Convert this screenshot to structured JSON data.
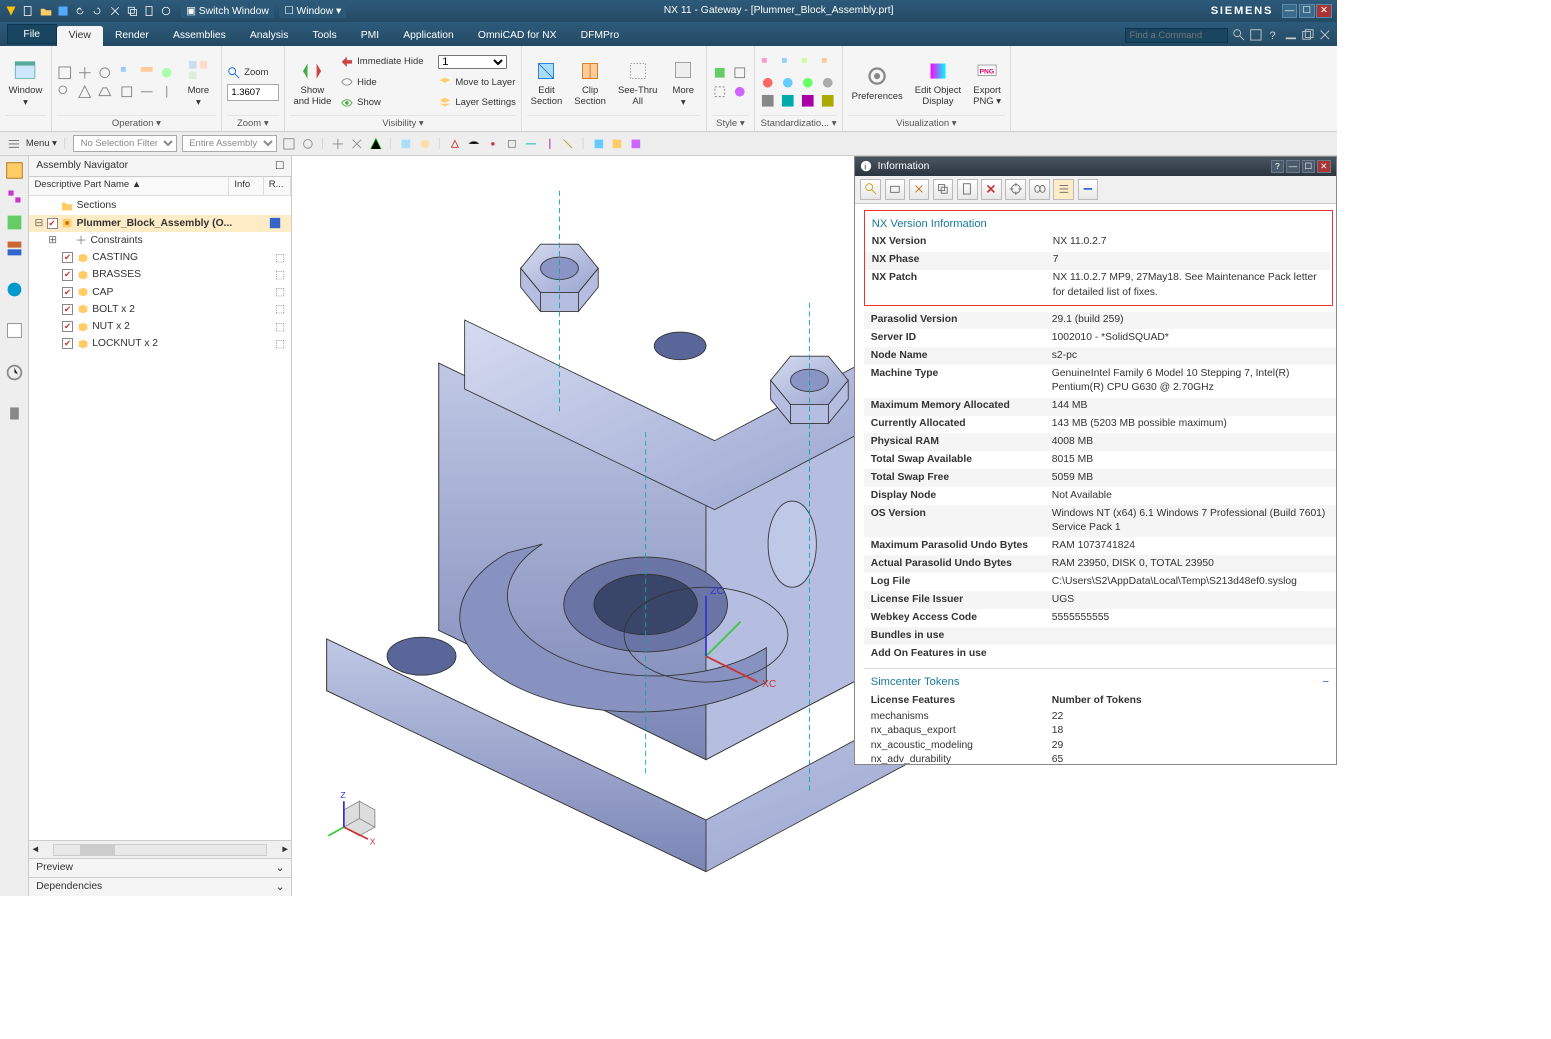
{
  "titlebar": {
    "switch_window": "Switch Window",
    "window_menu": "Window ▾",
    "title": "NX 11 - Gateway - [Plummer_Block_Assembly.prt]",
    "brand": "SIEMENS"
  },
  "tabs": {
    "file": "File",
    "view": "View",
    "render": "Render",
    "assemblies": "Assemblies",
    "analysis": "Analysis",
    "tools": "Tools",
    "pmi": "PMI",
    "application": "Application",
    "omnicad": "OmniCAD for NX",
    "dfmpro": "DFMPro",
    "find_placeholder": "Find a Command"
  },
  "ribbon": {
    "window": "Window",
    "operation_label": "Operation",
    "more1": "More",
    "zoom": "Zoom",
    "zoom_value": "1.3607",
    "zoom_label": "Zoom",
    "show_hide": "Show\nand Hide",
    "imm_hide": "Immediate Hide",
    "hide": "Hide",
    "show": "Show",
    "vis_combo": "1",
    "move_layer": "Move to Layer",
    "layer_settings": "Layer Settings",
    "visibility": "Visibility",
    "edit_section": "Edit\nSection",
    "clip_section": "Clip\nSection",
    "seethru": "See-Thru\nAll",
    "more2": "More",
    "style_label": "Style",
    "standard_label": "Standardizatio...",
    "prefs": "Preferences",
    "edit_obj": "Edit Object\nDisplay",
    "export_png": "Export\nPNG ▾",
    "viz_label": "Visualization"
  },
  "optbar": {
    "menu": "Menu ▾",
    "filter": "No Selection Filter",
    "scope": "Entire Assembly"
  },
  "nav": {
    "title": "Assembly Navigator",
    "col_name": "Descriptive Part Name  ▲",
    "col_info": "Info",
    "col_r": "R...",
    "sections": "Sections",
    "root": "Plummer_Block_Assembly (O...",
    "constraints": "Constraints",
    "casting": "CASTING",
    "brasses": "BRASSES",
    "cap": "CAP",
    "bolt": "BOLT x 2",
    "nut": "NUT x 2",
    "locknut": "LOCKNUT x 2",
    "preview": "Preview",
    "dependencies": "Dependencies"
  },
  "info": {
    "title": "Information",
    "section_header": "NX Version Information",
    "rows": [
      {
        "k": "NX Version",
        "v": "NX 11.0.2.7"
      },
      {
        "k": "NX Phase",
        "v": "7"
      },
      {
        "k": "NX Patch",
        "v": "NX 11.0.2.7 MP9, 27May18. See Maintenance Pack letter for detailed list of fixes."
      }
    ],
    "rows2": [
      {
        "k": "Parasolid Version",
        "v": "29.1 (build 259)"
      },
      {
        "k": "Server ID",
        "v": "1002010 - *SolidSQUAD*"
      },
      {
        "k": "Node Name",
        "v": "s2-pc"
      },
      {
        "k": "Machine Type",
        "v": "GenuineIntel Family 6 Model 10 Stepping 7, Intel(R) Pentium(R) CPU G630 @ 2.70GHz"
      },
      {
        "k": "Maximum Memory Allocated",
        "v": "144 MB"
      },
      {
        "k": "Currently Allocated",
        "v": "143 MB (5203 MB possible maximum)"
      },
      {
        "k": "Physical RAM",
        "v": "4008 MB"
      },
      {
        "k": "Total Swap Available",
        "v": "8015 MB"
      },
      {
        "k": "Total Swap Free",
        "v": "5059 MB"
      },
      {
        "k": "Display Node",
        "v": "Not Available"
      },
      {
        "k": "OS Version",
        "v": "Windows NT (x64) 6.1 Windows 7 Professional (Build 7601) Service Pack 1"
      },
      {
        "k": "Maximum Parasolid Undo Bytes",
        "v": "RAM 1073741824"
      },
      {
        "k": "Actual Parasolid Undo Bytes",
        "v": "RAM 23950, DISK 0, TOTAL 23950"
      },
      {
        "k": "Log File",
        "v": "C:\\Users\\S2\\AppData\\Local\\Temp\\S213d48ef0.syslog"
      },
      {
        "k": "License File Issuer",
        "v": "UGS"
      },
      {
        "k": "Webkey Access Code",
        "v": "5555555555"
      },
      {
        "k": "Bundles in use",
        "v": ""
      },
      {
        "k": "Add On Features in use",
        "v": ""
      }
    ],
    "simcenter": "Simcenter Tokens",
    "tok_h1": "License Features",
    "tok_h2": "Number of Tokens",
    "tokens": [
      {
        "k": "mechanisms",
        "v": "22"
      },
      {
        "k": "nx_abaqus_export",
        "v": "18"
      },
      {
        "k": "nx_acoustic_modeling",
        "v": "29"
      },
      {
        "k": "nx_adv_durability",
        "v": "65"
      }
    ]
  },
  "axis": {
    "x": "XC",
    "y": "",
    "z": "ZC"
  }
}
